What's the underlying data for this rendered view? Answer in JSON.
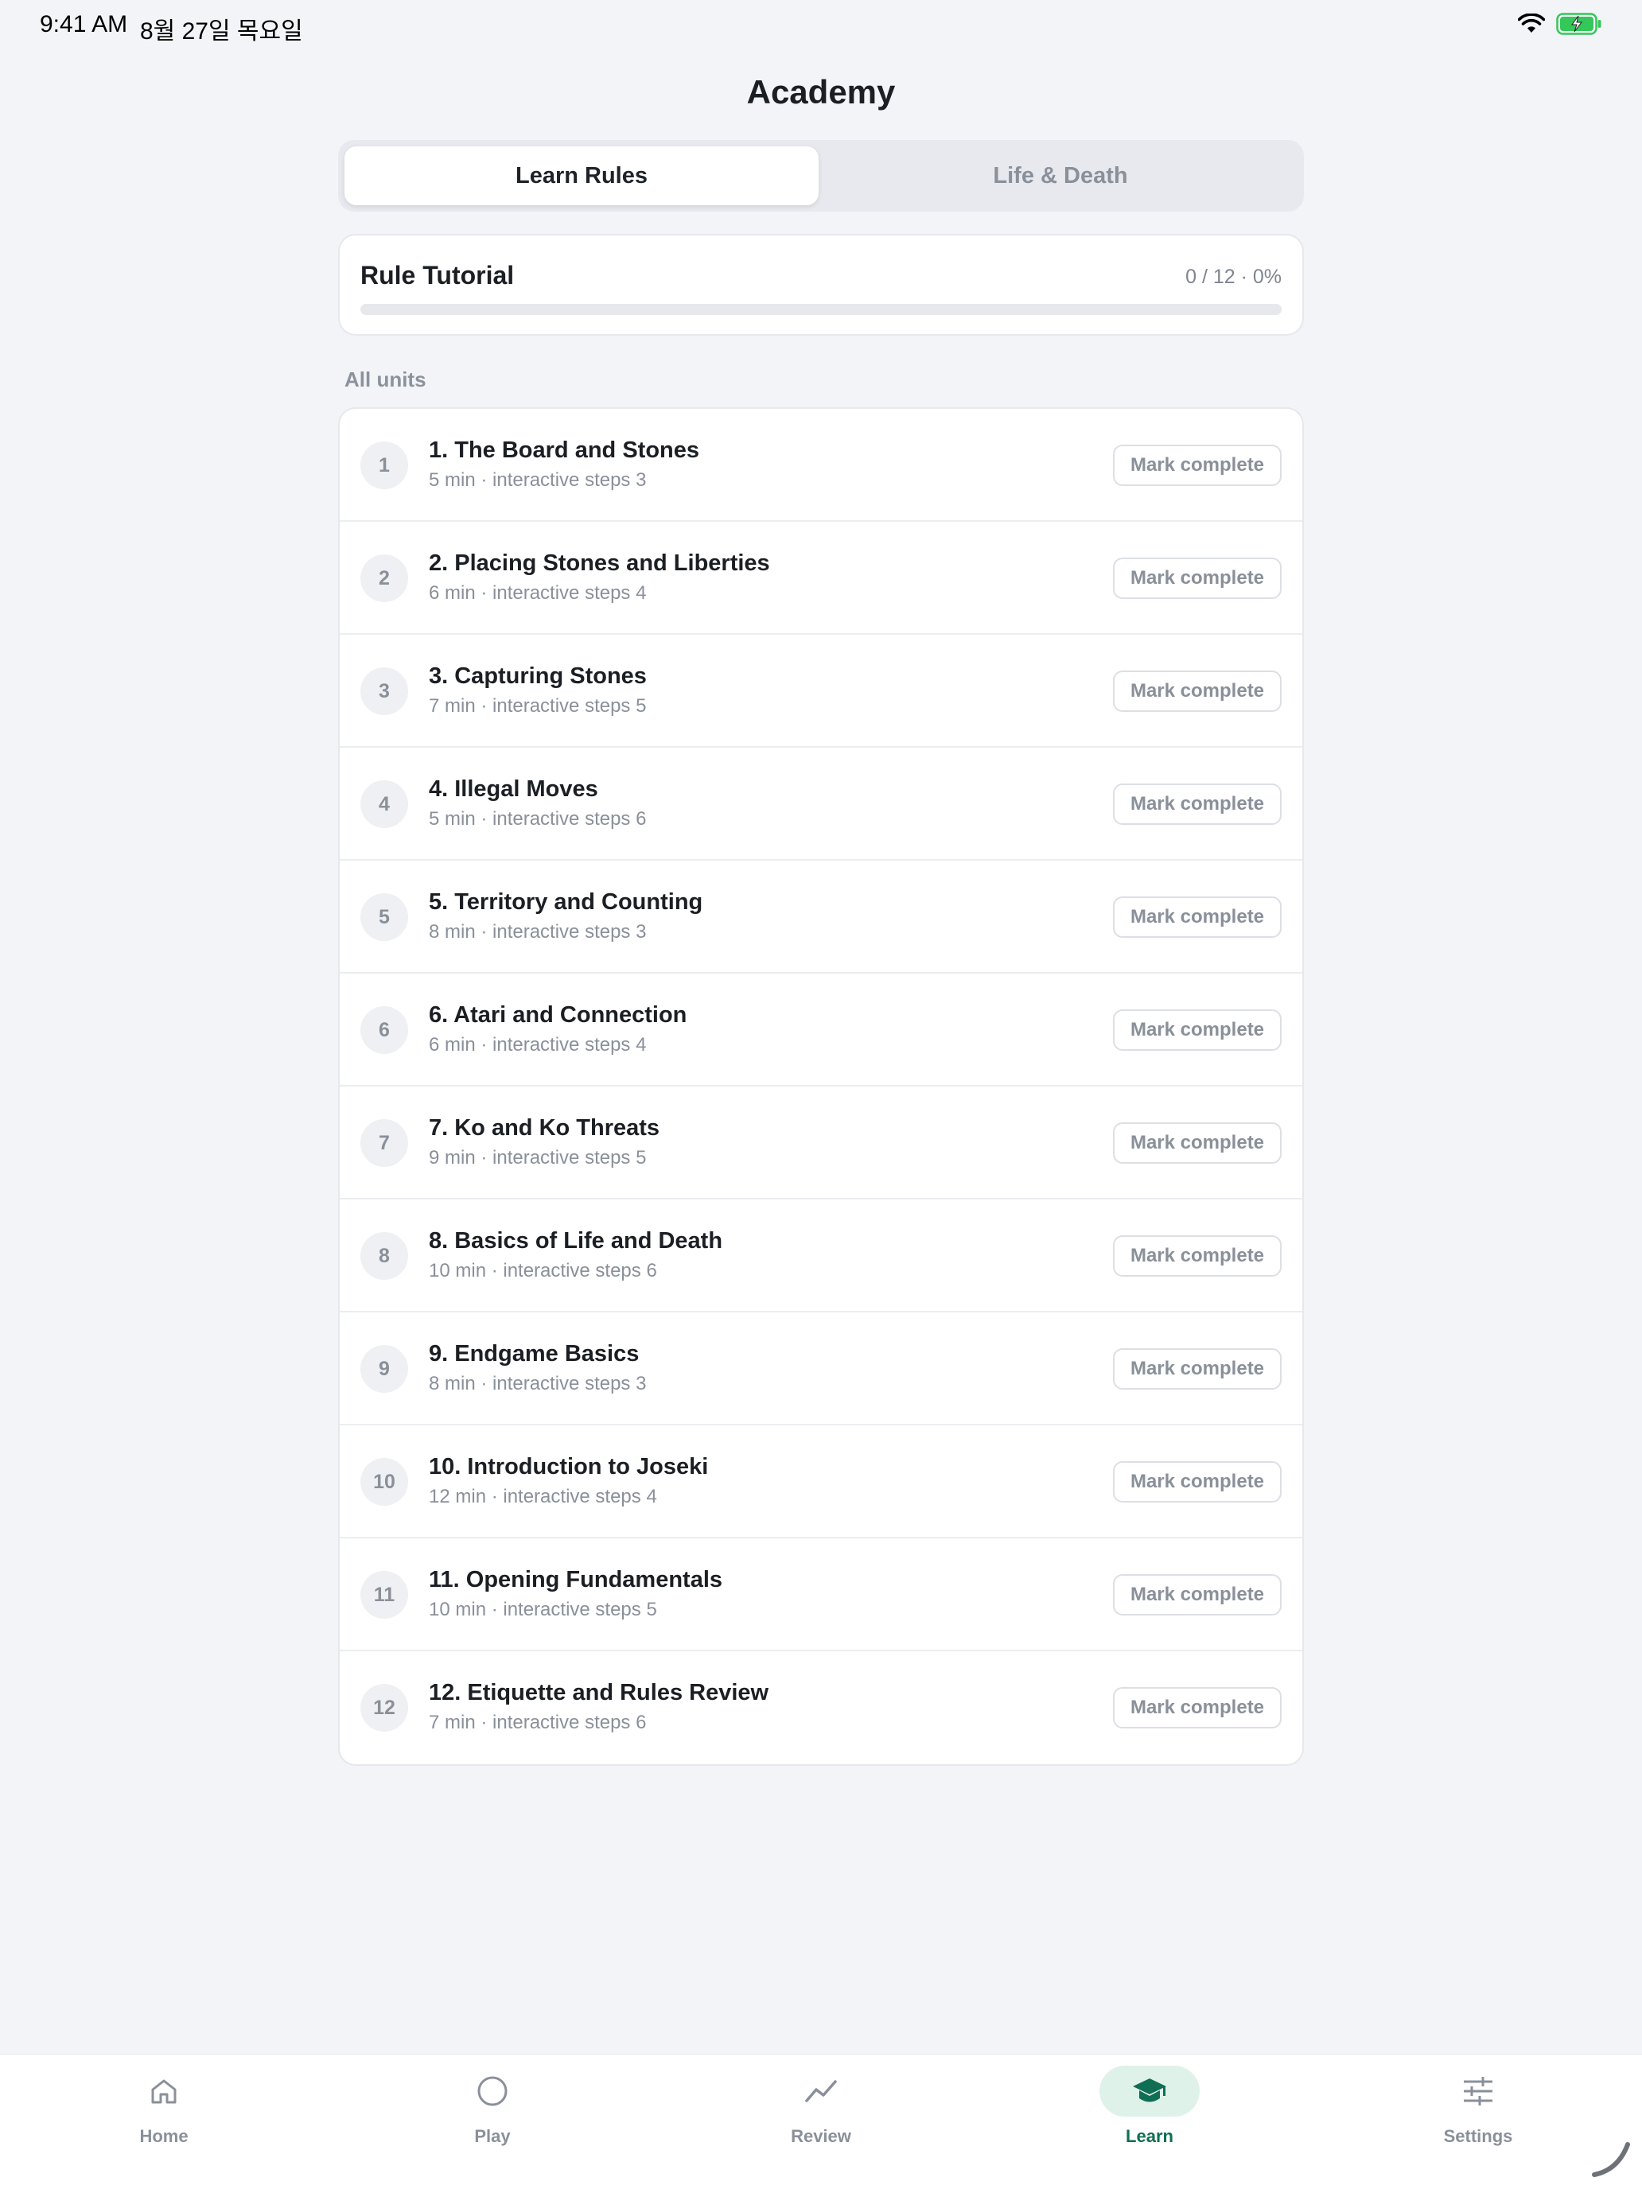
{
  "status_bar": {
    "time": "9:41 AM",
    "date": "8월 27일 목요일",
    "wifi_icon": "wifi-icon",
    "battery_icon": "battery-charging-icon"
  },
  "header": {
    "title": "Academy"
  },
  "segmented": {
    "tabs": [
      {
        "label": "Learn Rules",
        "selected": true
      },
      {
        "label": "Life & Death",
        "selected": false
      }
    ]
  },
  "tutorial": {
    "title": "Rule Tutorial",
    "progress_text": "0 / 12 · 0%",
    "progress_fraction": 0
  },
  "units_section": {
    "label": "All units"
  },
  "units": [
    {
      "number": "1",
      "title": "1. The Board and Stones",
      "meta": "5 min · interactive steps 3",
      "action": "Mark complete"
    },
    {
      "number": "2",
      "title": "2. Placing Stones and Liberties",
      "meta": "6 min · interactive steps 4",
      "action": "Mark complete"
    },
    {
      "number": "3",
      "title": "3. Capturing Stones",
      "meta": "7 min · interactive steps 5",
      "action": "Mark complete"
    },
    {
      "number": "4",
      "title": "4. Illegal Moves",
      "meta": "5 min · interactive steps 6",
      "action": "Mark complete"
    },
    {
      "number": "5",
      "title": "5. Territory and Counting",
      "meta": "8 min · interactive steps 3",
      "action": "Mark complete"
    },
    {
      "number": "6",
      "title": "6. Atari and Connection",
      "meta": "6 min · interactive steps 4",
      "action": "Mark complete"
    },
    {
      "number": "7",
      "title": "7. Ko and Ko Threats",
      "meta": "9 min · interactive steps 5",
      "action": "Mark complete"
    },
    {
      "number": "8",
      "title": "8. Basics of Life and Death",
      "meta": "10 min · interactive steps 6",
      "action": "Mark complete"
    },
    {
      "number": "9",
      "title": "9. Endgame Basics",
      "meta": "8 min · interactive steps 3",
      "action": "Mark complete"
    },
    {
      "number": "10",
      "title": "10. Introduction to Joseki",
      "meta": "12 min · interactive steps 4",
      "action": "Mark complete"
    },
    {
      "number": "11",
      "title": "11. Opening Fundamentals",
      "meta": "10 min · interactive steps 5",
      "action": "Mark complete"
    },
    {
      "number": "12",
      "title": "12. Etiquette and Rules Review",
      "meta": "7 min · interactive steps 6",
      "action": "Mark complete"
    }
  ],
  "tab_bar": {
    "items": [
      {
        "label": "Home",
        "icon": "home-icon",
        "active": false
      },
      {
        "label": "Play",
        "icon": "circle-icon",
        "active": false
      },
      {
        "label": "Review",
        "icon": "trend-icon",
        "active": false
      },
      {
        "label": "Learn",
        "icon": "graduation-cap-icon",
        "active": true
      },
      {
        "label": "Settings",
        "icon": "sliders-icon",
        "active": false
      }
    ]
  },
  "colors": {
    "accent": "#0F6E53",
    "accent_soft": "#DFF2EA",
    "background": "#F3F4F7",
    "muted_text": "#8A909A"
  }
}
